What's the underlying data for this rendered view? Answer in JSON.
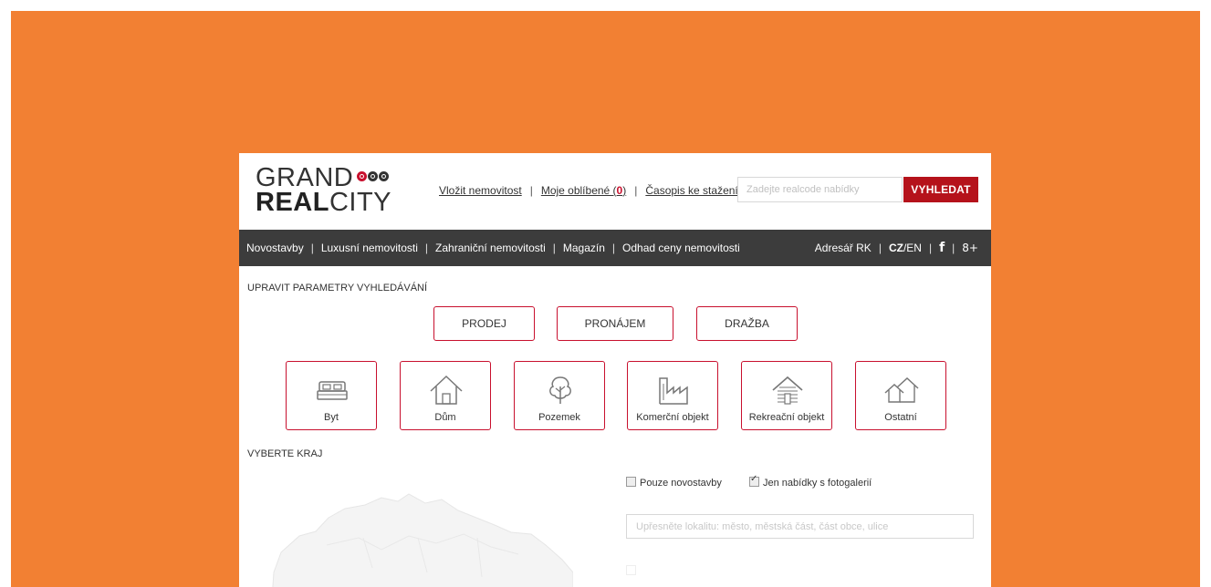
{
  "logo": {
    "line1": "GRAND",
    "line2_bold": "REAL",
    "line2_rest": "CITY"
  },
  "header": {
    "links": [
      {
        "label": "Vložit nemovitost"
      },
      {
        "label_prefix": "Moje oblíbené (",
        "count": "0",
        "label_suffix": ")"
      },
      {
        "label": "Časopis ke stažení"
      }
    ],
    "search_placeholder": "Zadejte realcode nabídky",
    "search_button": "VYHLEDAT"
  },
  "nav": {
    "items": [
      "Novostavby",
      "Luxusní nemovitosti",
      "Zahraniční nemovitosti",
      "Magazín",
      "Odhad ceny nemovitosti"
    ],
    "right": {
      "directory": "Adresář RK",
      "lang_active": "CZ",
      "lang_other": "/EN",
      "facebook": "f",
      "gplus": "8+"
    }
  },
  "search_params": {
    "title": "UPRAVIT PARAMETRY VYHLEDÁVÁNÍ",
    "transaction_types": [
      "PRODEJ",
      "PRONÁJEM",
      "DRAŽBA"
    ],
    "categories": [
      {
        "label": "Byt",
        "icon": "bed-icon"
      },
      {
        "label": "Dům",
        "icon": "house-icon"
      },
      {
        "label": "Pozemek",
        "icon": "tree-icon"
      },
      {
        "label": "Komerční objekt",
        "icon": "factory-icon"
      },
      {
        "label": "Rekreační objekt",
        "icon": "cabin-icon"
      },
      {
        "label": "Ostatní",
        "icon": "houses-icon"
      }
    ]
  },
  "region": {
    "title": "VYBERTE KRAJ",
    "only_new_label": "Pouze novostavby",
    "only_new_checked": false,
    "with_gallery_label": "Jen nabídky s fotogalerií",
    "with_gallery_checked": true,
    "location_placeholder": "Upřesněte lokalitu: město, městská část, část obce, ulice"
  },
  "colors": {
    "frame": "#f28033",
    "accent": "#c8102e",
    "nav_bg": "#3c3c3c",
    "button": "#b5121b"
  }
}
